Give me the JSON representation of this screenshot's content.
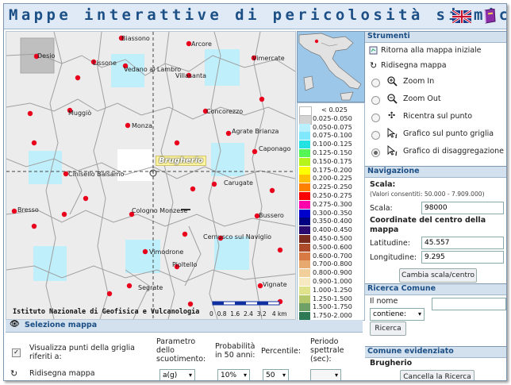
{
  "app": {
    "title": "Mappe interattive di pericolosità sismica",
    "flag_en": "uk-flag-icon",
    "help_icon": "book-icon"
  },
  "map": {
    "cities": [
      "Biassono",
      "Arcore",
      "Desio",
      "Vimercate",
      "Lissone",
      "Vedano al Lambro",
      "Villasanta",
      "Muggiò",
      "Concorezzo",
      "Monza",
      "Agrate Brianza",
      "Caponago",
      "Cinisello Balsamo",
      "Carugate",
      "Bresso",
      "Cologno Monzese",
      "Bussero",
      "Cernusco sul Naviglio",
      "Vimodrone",
      "Segrate",
      "Pioltello",
      "Vignate"
    ],
    "highlight": "Brugherio",
    "credit": "Istituto Nazionale di Geofisica e Vulcanologia",
    "scale_labels": [
      "0",
      "0.8",
      "1.6",
      "2.4",
      "3.2",
      "4 km"
    ]
  },
  "legend": {
    "entries": [
      {
        "label": "< 0.025",
        "color": "#ffffff"
      },
      {
        "label": "0.025-0.050",
        "color": "#d4d4d4"
      },
      {
        "label": "0.050-0.075",
        "color": "#b8f0ff"
      },
      {
        "label": "0.075-0.100",
        "color": "#7fe8ff"
      },
      {
        "label": "0.100-0.125",
        "color": "#22e2e2"
      },
      {
        "label": "0.125-0.150",
        "color": "#55f555"
      },
      {
        "label": "0.150-0.175",
        "color": "#b6f51b"
      },
      {
        "label": "0.175-0.200",
        "color": "#ffff00"
      },
      {
        "label": "0.200-0.225",
        "color": "#ffc000"
      },
      {
        "label": "0.225-0.250",
        "color": "#ff7f00"
      },
      {
        "label": "0.250-0.275",
        "color": "#ff0000"
      },
      {
        "label": "0.275-0.300",
        "color": "#ff00aa"
      },
      {
        "label": "0.300-0.350",
        "color": "#0000cc"
      },
      {
        "label": "0.350-0.400",
        "color": "#000080"
      },
      {
        "label": "0.400-0.450",
        "color": "#2a0a6e"
      },
      {
        "label": "0.450-0.500",
        "color": "#7a2b1e"
      },
      {
        "label": "0.500-0.600",
        "color": "#ad4a2a"
      },
      {
        "label": "0.600-0.700",
        "color": "#d77a44"
      },
      {
        "label": "0.700-0.800",
        "color": "#e7a970"
      },
      {
        "label": "0.800-0.900",
        "color": "#f0cf9a"
      },
      {
        "label": "0.900-1.000",
        "color": "#f6e8c0"
      },
      {
        "label": "1.000-1.250",
        "color": "#e0e28b"
      },
      {
        "label": "1.250-1.500",
        "color": "#b6c86c"
      },
      {
        "label": "1.500-1.750",
        "color": "#6ea067"
      },
      {
        "label": "1.750-2.000",
        "color": "#2e7a55"
      }
    ]
  },
  "panel": {
    "strumenti": {
      "heading": "Strumenti",
      "reset": "Ritorna alla mappa iniziale",
      "redraw": "Ridisegna mappa",
      "zoom_in": "Zoom In",
      "zoom_out": "Zoom Out",
      "recenter": "Ricentra sul punto",
      "grid_plot": "Grafico sul punto griglia",
      "disagg_plot": "Grafico di disaggregazione"
    },
    "navigazione": {
      "heading": "Navigazione",
      "scale_title": "Scala:",
      "scale_range": "(Valori consentiti: 50.000 - 7.909.000)",
      "scale_label": "Scala:",
      "scale_value": "98000",
      "center_title": "Coordinate del centro della mappa",
      "lat_label": "Latitudine:",
      "lat_value": "45.557",
      "lon_label": "Longitudine:",
      "lon_value": "9.295",
      "button": "Cambia scala/centro"
    },
    "ricerca": {
      "heading": "Ricerca Comune",
      "name_label": "Il nome",
      "mode": "contiene:",
      "query": "",
      "button": "Ricerca"
    },
    "evidenziato": {
      "heading": "Comune evidenziato",
      "name": "Brugherio",
      "button": "Cancella la Ricerca"
    }
  },
  "selezione": {
    "heading": "Selezione mappa",
    "show_points": "Visualizza punti della griglia riferiti a:",
    "redraw": "Ridisegna mappa",
    "param_label": "Parametro dello scuotimento:",
    "param_value": "a(g)",
    "prob_label": "Probabilità in 50 anni:",
    "prob_value": "10%",
    "perc_label": "Percentile:",
    "perc_value": "50",
    "period_label": "Periodo spettrale (sec):",
    "period_value": ""
  }
}
